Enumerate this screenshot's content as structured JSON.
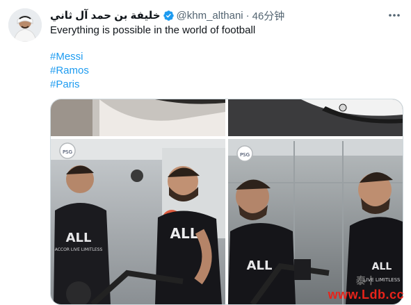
{
  "tweet": {
    "author_name": "خليفة بن حمد آل ثاني",
    "handle": "@khm_althani",
    "separator": "·",
    "time": "46分钟",
    "text": "Everything is possible in the world of football",
    "hashtags": [
      "#Messi",
      "#Ramos",
      "#Paris"
    ]
  },
  "media": {
    "jersey_text_left": "ALL",
    "jersey_sponsor_left": "ACCOR LIVE LIMITLESS",
    "jersey_text_right": "ALL",
    "jersey_sponsor_right": "LIVE LIMITLESS",
    "crest_label": "PARIS SAINT-GERMAIN"
  },
  "watermark": {
    "chinese": "泰丨",
    "url": "www.Ldb.cc"
  },
  "colors": {
    "link": "#1d9bf0",
    "verified": "#1d9bf0",
    "watermark": "#e8231a",
    "secondary_text": "#536471"
  }
}
